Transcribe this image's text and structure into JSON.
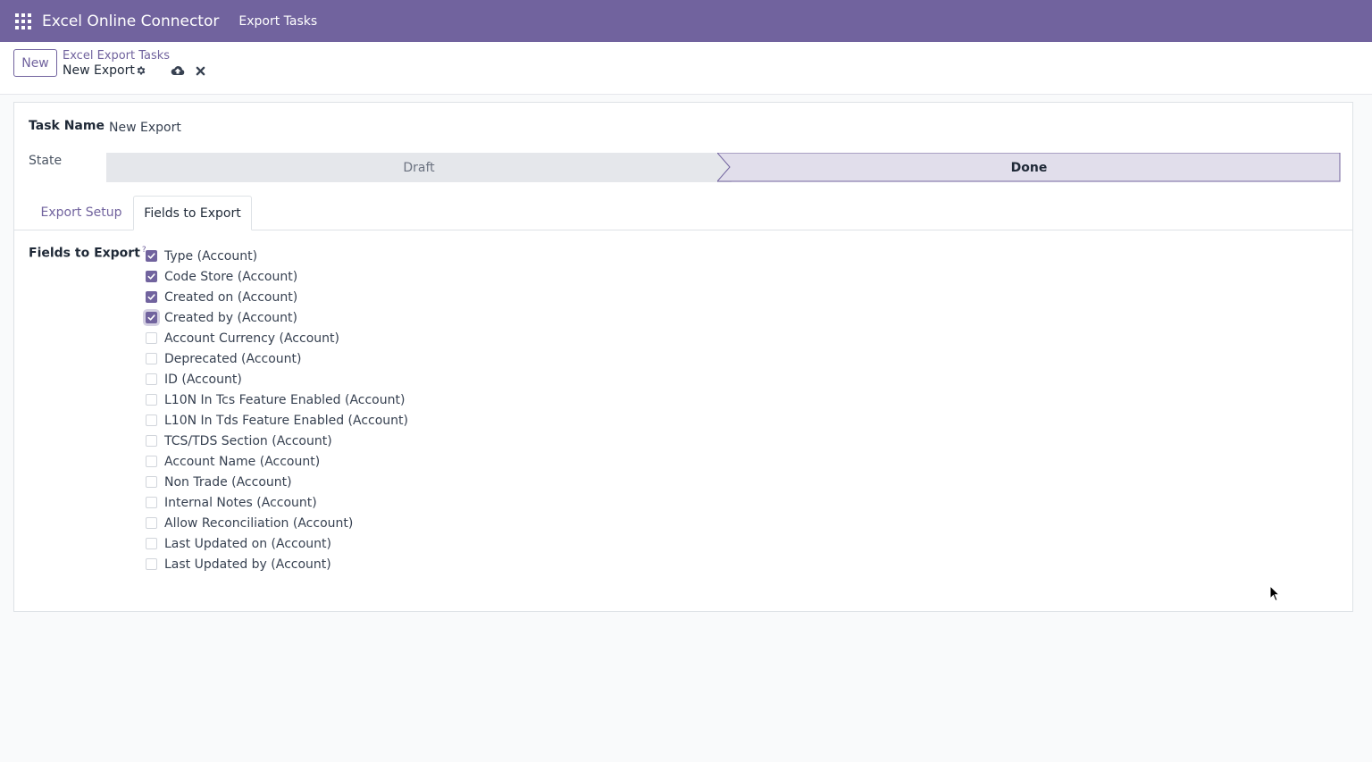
{
  "navbar": {
    "app_title": "Excel Online Connector",
    "menu_item": "Export Tasks"
  },
  "control_panel": {
    "new_label": "New",
    "breadcrumb_parent": "Excel Export Tasks",
    "breadcrumb_current": "New Export"
  },
  "form": {
    "task_name_label": "Task Name",
    "task_name_value": "New Export",
    "state_label": "State",
    "states": [
      "Draft",
      "Done"
    ],
    "current_state": "Done",
    "tabs": [
      "Export Setup",
      "Fields to Export"
    ],
    "active_tab": "Fields to Export",
    "fields_label": "Fields to Export",
    "fields_help": "?",
    "fields": [
      {
        "label": "Type (Account)",
        "checked": true
      },
      {
        "label": "Code Store (Account)",
        "checked": true
      },
      {
        "label": "Created on (Account)",
        "checked": true
      },
      {
        "label": "Created by (Account)",
        "checked": true,
        "focused": true
      },
      {
        "label": "Account Currency (Account)",
        "checked": false
      },
      {
        "label": "Deprecated (Account)",
        "checked": false
      },
      {
        "label": "ID (Account)",
        "checked": false
      },
      {
        "label": "L10N In Tcs Feature Enabled (Account)",
        "checked": false
      },
      {
        "label": "L10N In Tds Feature Enabled (Account)",
        "checked": false
      },
      {
        "label": "TCS/TDS Section (Account)",
        "checked": false
      },
      {
        "label": "Account Name (Account)",
        "checked": false
      },
      {
        "label": "Non Trade (Account)",
        "checked": false
      },
      {
        "label": "Internal Notes (Account)",
        "checked": false
      },
      {
        "label": "Allow Reconciliation (Account)",
        "checked": false
      },
      {
        "label": "Last Updated on (Account)",
        "checked": false
      },
      {
        "label": "Last Updated by (Account)",
        "checked": false
      }
    ]
  },
  "colors": {
    "brand": "#71639e",
    "status_inactive": "#e5e7eb",
    "status_active": "#e1deeb"
  },
  "icons": {
    "apps": "grid-icon",
    "gear": "gear-icon",
    "save": "cloud-upload-icon",
    "discard": "close-icon",
    "cursor": "mouse-pointer-icon"
  }
}
